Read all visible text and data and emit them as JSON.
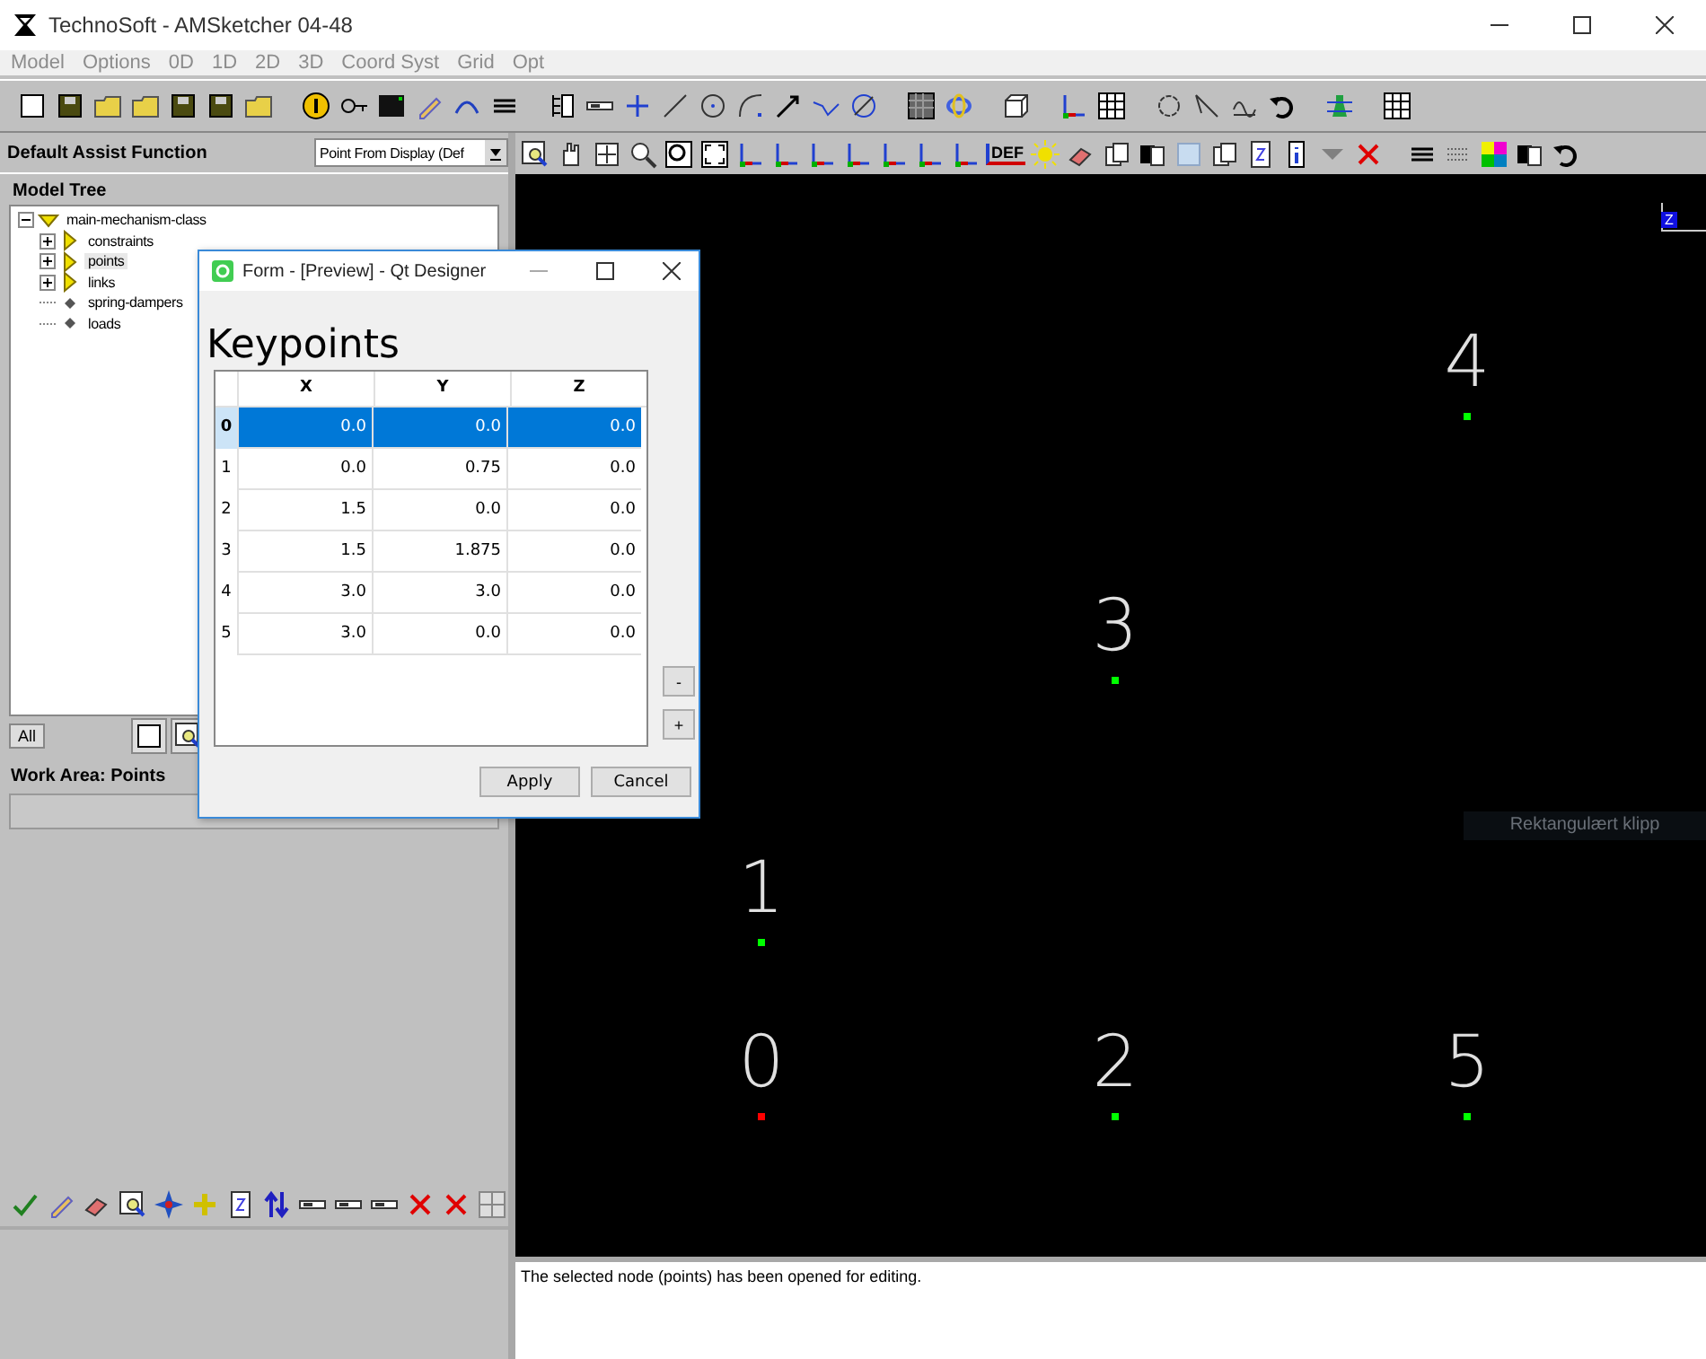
{
  "window": {
    "title": "TechnoSoft - AMSketcher 04-48"
  },
  "menu": [
    {
      "label": "Model",
      "disabled": true
    },
    {
      "label": "Options",
      "disabled": true
    },
    {
      "label": "0D",
      "disabled": true
    },
    {
      "label": "1D",
      "disabled": true
    },
    {
      "label": "2D",
      "disabled": true
    },
    {
      "label": "3D",
      "disabled": true
    },
    {
      "label": "Coord Syst",
      "disabled": true
    },
    {
      "label": "Grid",
      "disabled": true
    },
    {
      "label": "Opt",
      "disabled": true
    }
  ],
  "assist": {
    "label": "Default Assist Function",
    "dropdown_value": "Point From Display (Def"
  },
  "view_toolbar": {
    "def_label": "DEF"
  },
  "model_tree": {
    "title": "Model Tree",
    "items": [
      {
        "label": "main-mechanism-class",
        "kind": "folder",
        "expanded": true,
        "selected": false,
        "children": [
          {
            "label": "constraints",
            "kind": "folder",
            "expanded": false,
            "selected": false
          },
          {
            "label": "points",
            "kind": "folder",
            "expanded": false,
            "selected": true
          },
          {
            "label": "links",
            "kind": "folder",
            "expanded": false,
            "selected": false
          },
          {
            "label": "spring-dampers",
            "kind": "leaf",
            "selected": false
          },
          {
            "label": "loads",
            "kind": "leaf",
            "selected": false
          }
        ]
      }
    ]
  },
  "tree_buttons": {
    "all_label": "All"
  },
  "work_area": {
    "title": "Work Area: Points"
  },
  "canvas": {
    "axis_label": "Z",
    "tooltip": "Rektangulært klipp",
    "points": [
      {
        "label": "0",
        "color": "#ff0000"
      },
      {
        "label": "1",
        "color": "#00ff00"
      },
      {
        "label": "2",
        "color": "#00ff00"
      },
      {
        "label": "3",
        "color": "#00ff00"
      },
      {
        "label": "4",
        "color": "#00ff00"
      },
      {
        "label": "5",
        "color": "#00ff00"
      }
    ]
  },
  "status": {
    "message": "The selected node (points) has been opened for editing."
  },
  "dialog": {
    "title": "Form - [Preview] - Qt Designer",
    "heading": "Keypoints",
    "columns": [
      "X",
      "Y",
      "Z"
    ],
    "rows": [
      {
        "header": "0",
        "cells": [
          "0.0",
          "0.0",
          "0.0"
        ],
        "selected": true
      },
      {
        "header": "1",
        "cells": [
          "0.0",
          "0.75",
          "0.0"
        ],
        "selected": false
      },
      {
        "header": "2",
        "cells": [
          "1.5",
          "0.0",
          "0.0"
        ],
        "selected": false
      },
      {
        "header": "3",
        "cells": [
          "1.5",
          "1.875",
          "0.0"
        ],
        "selected": false
      },
      {
        "header": "4",
        "cells": [
          "3.0",
          "3.0",
          "0.0"
        ],
        "selected": false
      },
      {
        "header": "5",
        "cells": [
          "3.0",
          "0.0",
          "0.0"
        ],
        "selected": false
      }
    ],
    "remove_label": "-",
    "add_label": "+",
    "buttons": [
      "Apply",
      "Cancel"
    ]
  }
}
